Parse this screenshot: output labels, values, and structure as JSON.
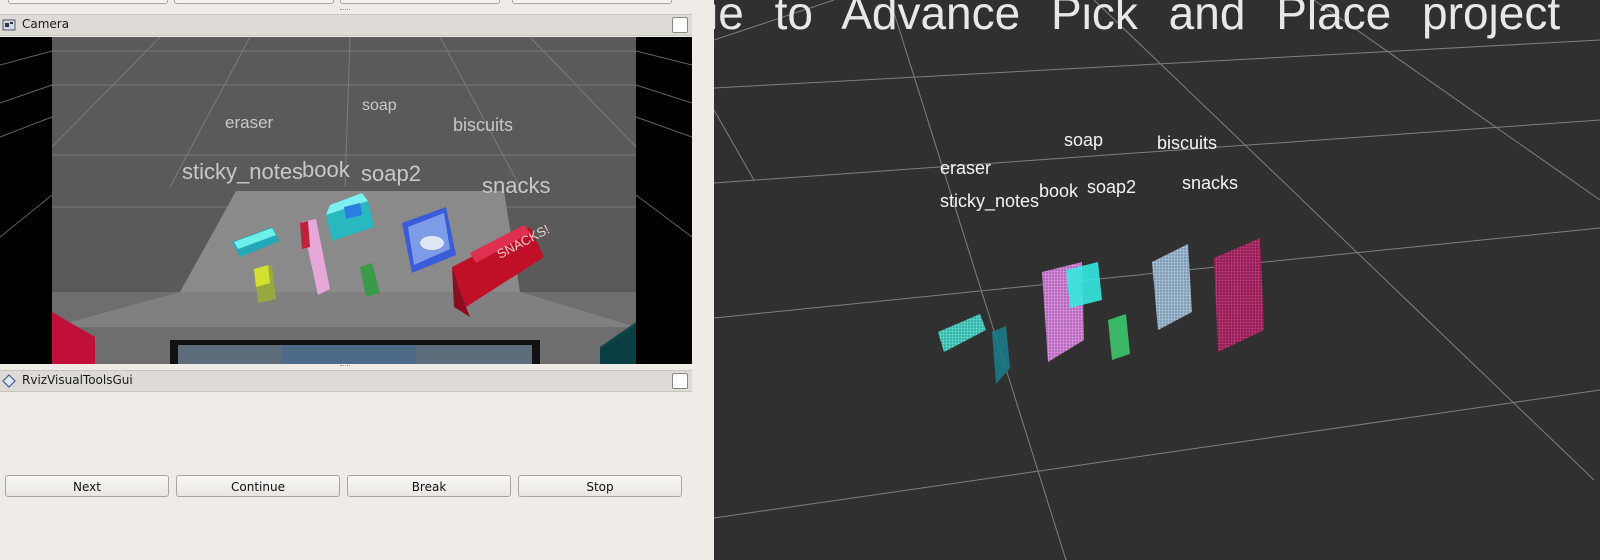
{
  "camera_panel": {
    "title": "Camera",
    "labels": {
      "eraser": "eraser",
      "soap": "soap",
      "biscuits": "biscuits",
      "sticky_notes": "sticky_notes",
      "book": "book",
      "soap2": "soap2",
      "snacks": "snacks"
    },
    "snacks_box_text": "SNACKS!"
  },
  "tools_panel": {
    "title": "RvizVisualToolsGui",
    "buttons": {
      "next": "Next",
      "continue": "Continue",
      "break": "Break",
      "stop": "Stop"
    }
  },
  "viewport_3d": {
    "banner_text": "ie to Advance Pick and Place project",
    "labels": {
      "eraser": "eraser",
      "soap": "soap",
      "biscuits": "biscuits",
      "sticky_notes": "sticky_notes",
      "book": "book",
      "soap2": "soap2",
      "snacks": "snacks"
    }
  },
  "colors": {
    "viewport_bg": "#303030",
    "grid_line": "#8a8a8a",
    "panel_bg": "#efebe7",
    "eraser_cloud": "#35e0d0",
    "book_cloud": "#e27ae8",
    "soap2_cloud": "#3bbf68",
    "biscuits_cloud": "#9cc2e0",
    "snacks_cloud": "#b0105a"
  }
}
